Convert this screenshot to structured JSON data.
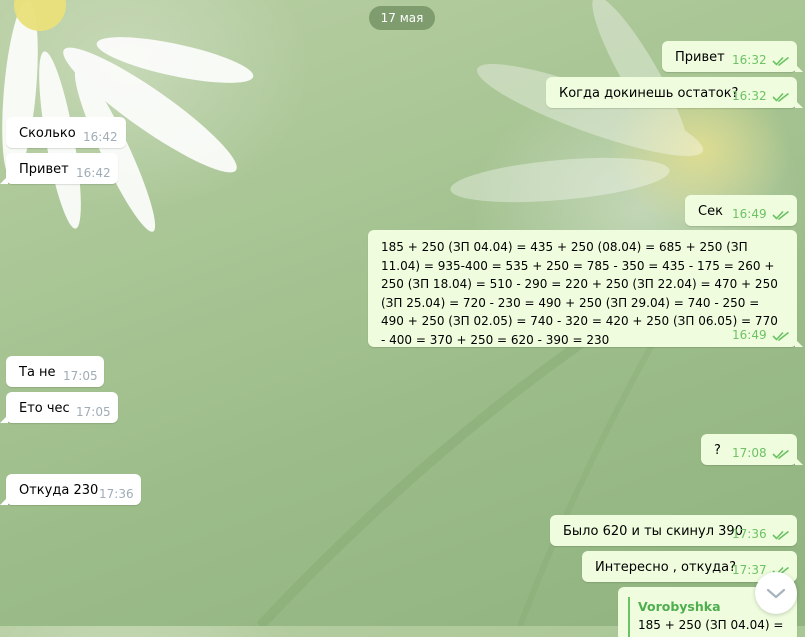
{
  "date_divider": "17 мая",
  "colors": {
    "incoming_bg": "#ffffff",
    "outgoing_bg": "#effdde",
    "check_color": "#6cc264",
    "time_in": "#a0acb6"
  },
  "messages": [
    {
      "dir": "out",
      "text": "Привет",
      "time": "16:32",
      "read": true
    },
    {
      "dir": "out",
      "text": "Когда докинешь остаток?",
      "time": "16:32",
      "read": true
    },
    {
      "dir": "in",
      "text": "Сколько",
      "time": "16:42"
    },
    {
      "dir": "in",
      "text": "Привет",
      "time": "16:42"
    },
    {
      "dir": "out",
      "text": "Сек",
      "time": "16:49",
      "read": true
    },
    {
      "dir": "out",
      "text": "185 + 250 (ЗП 04.04) = 435 + 250 (08.04) = 685 + 250 (ЗП 11.04) = 935-400 = 535 + 250 = 785 - 350 = 435 - 175 = 260 + 250 (ЗП 18.04) = 510 - 290 = 220 + 250 (ЗП 22.04) = 470 + 250 (ЗП 25.04) = 720 - 230 = 490 + 250 (ЗП 29.04) = 740 - 250 = 490 + 250 (ЗП 02.05) = 740 - 320 = 420 + 250 (ЗП 06.05) = 770 - 400 = 370 + 250 = 620 - 390 = 230",
      "time": "16:49",
      "read": true
    },
    {
      "dir": "in",
      "text": "Та не",
      "time": "17:05"
    },
    {
      "dir": "in",
      "text": "Ето чес",
      "time": "17:05"
    },
    {
      "dir": "out",
      "text": "?",
      "time": "17:08",
      "read": true
    },
    {
      "dir": "in",
      "text": "Откуда 230",
      "time": "17:36"
    },
    {
      "dir": "out",
      "text": "Было 620 и ты скинул 390",
      "time": "17:36",
      "read": true
    },
    {
      "dir": "out",
      "text": "Интересно , откуда?",
      "time": "17:37",
      "read": true
    },
    {
      "dir": "out",
      "reply_name": "Vorobyshka",
      "reply_text": "185 + 250 (ЗП 04.04) ="
    }
  ],
  "scroll_button_icon": "chevron-down-icon"
}
